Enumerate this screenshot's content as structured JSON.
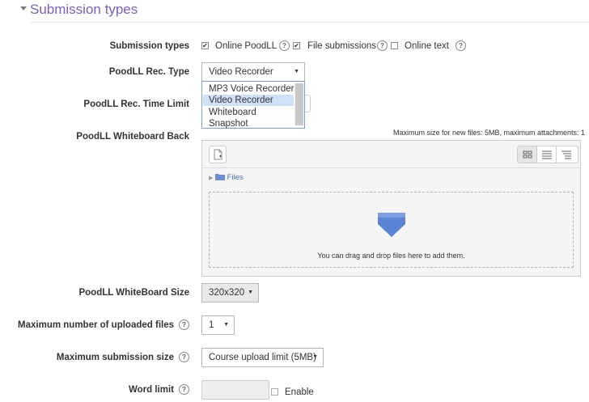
{
  "section": {
    "title": "Submission types"
  },
  "submission_types": {
    "label": "Submission types",
    "options": [
      {
        "label": "Online PoodLL",
        "checked": true
      },
      {
        "label": "File submissions",
        "checked": true
      },
      {
        "label": "Online text",
        "checked": false
      }
    ]
  },
  "rec_type": {
    "label": "PoodLL Rec. Type",
    "selected": "Video Recorder",
    "options": [
      "MP3 Voice Recorder",
      "Video Recorder",
      "Whiteboard",
      "Snapshot"
    ]
  },
  "time_limit": {
    "label": "PoodLL Rec. Time Limit"
  },
  "whiteboard_back": {
    "label": "PoodLL Whiteboard Back",
    "max_size_note": "Maximum size for new files: 5MB, maximum attachments: 1",
    "path_label": "Files",
    "drop_text": "You can drag and drop files here to add them."
  },
  "whiteboard_size": {
    "label": "PoodLL WhiteBoard Size",
    "value": "320x320"
  },
  "max_files": {
    "label": "Maximum number of uploaded files",
    "value": "1"
  },
  "max_size": {
    "label": "Maximum submission size",
    "value": "Course upload limit (5MB)"
  },
  "word_limit": {
    "label": "Word limit",
    "enable_label": "Enable",
    "enabled": false
  },
  "icons": {
    "help": "?",
    "check": "✔",
    "arrow": "▼"
  },
  "colors": {
    "accent": "#7a5fc0",
    "link": "#4f6fae",
    "selected_option": "#cfe0f7",
    "drop_arrow": "#5b83d6"
  }
}
